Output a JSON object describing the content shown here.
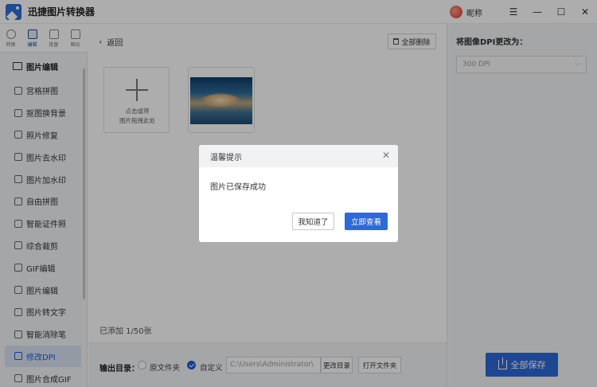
{
  "app": {
    "title": "迅捷图片转换器",
    "nickname": "昵称",
    "window_buttons": {
      "menu": "☰",
      "minimize": "—",
      "maximize": "☐",
      "close": "✕"
    }
  },
  "iconbar": [
    {
      "label": "转换",
      "icon": "convert-icon"
    },
    {
      "label": "编辑",
      "icon": "edit-icon",
      "active": true
    },
    {
      "label": "批量",
      "icon": "batch-icon"
    },
    {
      "label": "图玩",
      "icon": "image-play-icon"
    }
  ],
  "sidebar": {
    "section": "图片编辑",
    "items": [
      {
        "label": "宫格拼图"
      },
      {
        "label": "抠图换背景"
      },
      {
        "label": "照片修复"
      },
      {
        "label": "图片去水印"
      },
      {
        "label": "图片加水印"
      },
      {
        "label": "自由拼图"
      },
      {
        "label": "智能证件照"
      },
      {
        "label": "综合裁剪"
      },
      {
        "label": "GIF编辑"
      },
      {
        "label": "图片编辑"
      },
      {
        "label": "图片转文字"
      },
      {
        "label": "智能消除笔"
      },
      {
        "label": "修改DPI",
        "active": true
      },
      {
        "label": "图片合成GIF"
      }
    ]
  },
  "main": {
    "back_label": "返回",
    "delete_all_label": "全部删除",
    "add_tile_line1": "点击或将",
    "add_tile_line2": "图片拖拽此处",
    "added_count": "已添加 1/50张"
  },
  "bottom": {
    "output_label": "输出目录：",
    "option_original": "原文件夹",
    "option_custom": "自定义",
    "path_value": "C:\\Users\\Administrator\\",
    "change_dir_label": "更改目录",
    "open_folder_label": "打开文件夹"
  },
  "right_panel": {
    "dpi_title": "将图像DPI更改为：",
    "dpi_value": "300 DPI",
    "save_all_label": "全部保存"
  },
  "dialog": {
    "title": "温馨提示",
    "message": "图片已保存成功",
    "ok_label": "我知道了",
    "view_label": "立即查看"
  },
  "colors": {
    "accent": "#2f69d6",
    "active_bg": "#dbe4f3",
    "overlay": "rgba(0,0,0,0.32)"
  }
}
